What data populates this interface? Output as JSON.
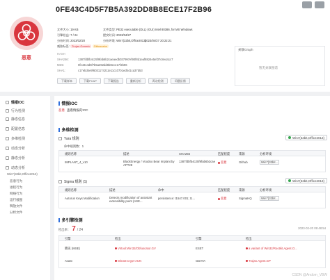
{
  "header": {
    "hash_title": "0FE43C4D5F7B5A392DD8B8ECE17F2B96",
    "verdict": "恶意",
    "file_size_label": "文件大小:",
    "file_size": "19 KB",
    "file_type_label": "文件类型:",
    "file_type": "PE32 executable (DLL) (GUI) Intel 80386, for MS Windows",
    "detect_ratio_label": "引擎检出:",
    "detect_ratio": "7 / 24",
    "submit_time_label": "提交时间:",
    "submit_time": "2023/04/27",
    "analysis_env_label": "分析环境:",
    "analysis_env": "Win7(32bit,Office2013)",
    "analysis_time_label": "分析时间:",
    "analysis_time": "2023/02/20",
    "analysis_time2": "2023/04/27 20:22:21",
    "tags_label": "威胁标签:",
    "tags": [
      "Trojan.Generic",
      "Obfuscator"
    ],
    "hash_label": "HASH",
    "sha256_label": "SHA256:",
    "sha256": "1387fdbfb4c25f9fab6b2caeaedb037997ef90f8d1eaf8824e5ef37c8e4a1c7",
    "md5_label": "MD5:",
    "md5": "0fe43c4d5f7b5a392dd8b8ece17f2b96",
    "sha1_label": "SHA1:",
    "sha1": "c17ebd4e9f6031174211e11c10701edb41ca37d53",
    "buttons": [
      "下载样本",
      "下载PCAP",
      "下载报告",
      "重新分析",
      "再次检测",
      "问题反馈"
    ],
    "graph_title": "关联Graph",
    "graph_empty": "暂无关联图谱"
  },
  "sidebar": {
    "items": [
      {
        "label": "情报IOC",
        "active": true
      },
      {
        "label": "行为检测"
      },
      {
        "label": "静态信息"
      },
      {
        "label": "配置信息"
      },
      {
        "label": "多维检测"
      },
      {
        "label": "动态分析"
      },
      {
        "label": "静态分析"
      },
      {
        "label": "动态分析"
      }
    ],
    "env_label": "Win7(32bit,Office2013)",
    "sub_items": [
      "恶意行为",
      "进程行为",
      "网络行为",
      "运行截图",
      "释放文件",
      "分析文件"
    ]
  },
  "main": {
    "ioc_title": "情报IOC",
    "threat_tag": "恶意",
    "threat_text": "查看情报的IOC",
    "multi_title": "多维检测",
    "yara_title": "Yara 规则",
    "yara_count_label": "命中规则数：",
    "yara_count": "1",
    "env_select": "Win7(32bit,Office2013)",
    "yara_headers": [
      "规则名称",
      "描述",
      "SHA256",
      "匹配程度",
      "来源",
      "分析环境"
    ],
    "yara_row": {
      "name": "IMPLANT_4_v10",
      "desc": "BlackEnergy / Voodoo Bear Implant by APT28",
      "sha256": "1387fdbfb4c25f9fab6b2caeaedb037997ef90f8...",
      "match": "恶意",
      "source": "Github",
      "env": "Win7(32bit..."
    },
    "sigma_title": "Sigma 规则 (1)",
    "sigma_headers": [
      "规则名称",
      "描述",
      "命中",
      "匹配程度",
      "来源",
      "分析环境"
    ],
    "sigma_row": {
      "name": "Autorun Keys Modification",
      "desc": "Detects modification of autostart extensibility point (ASE...",
      "hit": "persistence: t1547.001; t1...",
      "match": "恶意",
      "source": "SigmaHQ",
      "env": "Win7(32bit..."
    },
    "engine_title": "多引擎检测",
    "engine_date": "2023-02-20 09:48:54",
    "engine_ratio_label": "检出率：",
    "engine_ratio_num": "7",
    "engine_ratio_den": "/ 24",
    "engine_headers": [
      "引擎",
      "检出",
      "引擎",
      "检出"
    ],
    "engine_rows": [
      [
        "腾讯 (MSE)",
        "Virtool:Win32/Obfuscator.GV",
        "ESET",
        "a variant of Win32/Rootkit.Agent.O..."
      ],
      [
        "Avast",
        "Win32:Crypt-AUN",
        "GDATA",
        "Trojan.Agent.GP"
      ]
    ],
    "watermark": "CSDN @Andom_VBW"
  }
}
